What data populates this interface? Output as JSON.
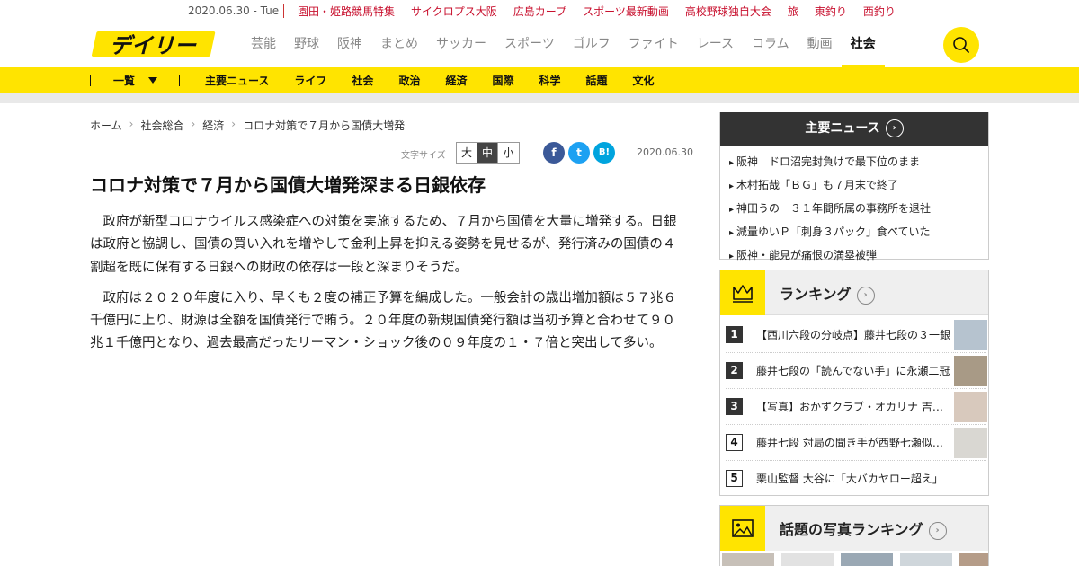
{
  "topbar": {
    "date": "2020.06.30 - Tue",
    "links": [
      "園田・姫路競馬特集",
      "サイクロプス大阪",
      "広島カープ",
      "スポーツ最新動画",
      "高校野球独自大会",
      "旅",
      "東釣り",
      "西釣り"
    ]
  },
  "header": {
    "logo_text": "デイリー",
    "nav": [
      "芸能",
      "野球",
      "阪神",
      "まとめ",
      "サッカー",
      "スポーツ",
      "ゴルフ",
      "ファイト",
      "レース",
      "コラム",
      "動画",
      "社会"
    ],
    "active_nav": "社会"
  },
  "subnav": {
    "list_label": "一覧",
    "items": [
      "主要ニュース",
      "ライフ",
      "社会",
      "政治",
      "経済",
      "国際",
      "科学",
      "話題",
      "文化"
    ]
  },
  "breadcrumb": [
    "ホーム",
    "社会総合",
    "経済",
    "コロナ対策で７月から国債大増発"
  ],
  "tools": {
    "font_size_label": "文字サイズ",
    "sizes": [
      "大",
      "中",
      "小"
    ],
    "share": [
      "f",
      "t",
      "B!"
    ],
    "date": "2020.06.30"
  },
  "article": {
    "title": "コロナ対策で７月から国債大増発深まる日銀依存",
    "paragraphs": [
      "政府が新型コロナウイルス感染症への対策を実施するため、７月から国債を大量に増発する。日銀は政府と協調し、国債の買い入れを増やして金利上昇を抑える姿勢を見せるが、発行済みの国債の４割超を既に保有する日銀への財政の依存は一段と深まりそうだ。",
      "政府は２０２０年度に入り、早くも２度の補正予算を編成した。一般会計の歳出増加額は５７兆６千億円に上り、財源は全額を国債発行で賄う。２０年度の新規国債発行額は当初予算と合わせて９０兆１千億円となり、過去最高だったリーマン・ショック後の０９年度の１・７倍と突出して多い。"
    ]
  },
  "main_news": {
    "title": "主要ニュース",
    "items": [
      "阪神　ドロ沼完封負けで最下位のまま",
      "木村拓哉「ＢＧ」も７月末で終了",
      "神田うの　３１年間所属の事務所を退社",
      "減量ゆいＰ「刺身３パック」食べていた",
      "阪神・能見が痛恨の満塁被弾"
    ]
  },
  "ranking": {
    "title": "ランキング",
    "items": [
      {
        "rank": "1",
        "text": "【西川六段の分岐点】藤井七段の３一銀"
      },
      {
        "rank": "2",
        "text": "藤井七段の「読んでない手」に永瀬二冠"
      },
      {
        "rank": "3",
        "text": "【写真】おかずクラブ・オカリナ 吉岡里帆"
      },
      {
        "rank": "4",
        "text": "藤井七段 対局の聞き手が西野七瀬似で話題"
      },
      {
        "rank": "5",
        "text": "栗山監督 大谷に「大バカヤロー超え」"
      }
    ]
  },
  "photo_ranking": {
    "title": "話題の写真ランキング"
  },
  "colors": {
    "accent": "#ffe400",
    "topbar_link": "#c8102e",
    "facebook": "#3b5998",
    "twitter": "#1da1f2",
    "hatena": "#00a4de"
  }
}
